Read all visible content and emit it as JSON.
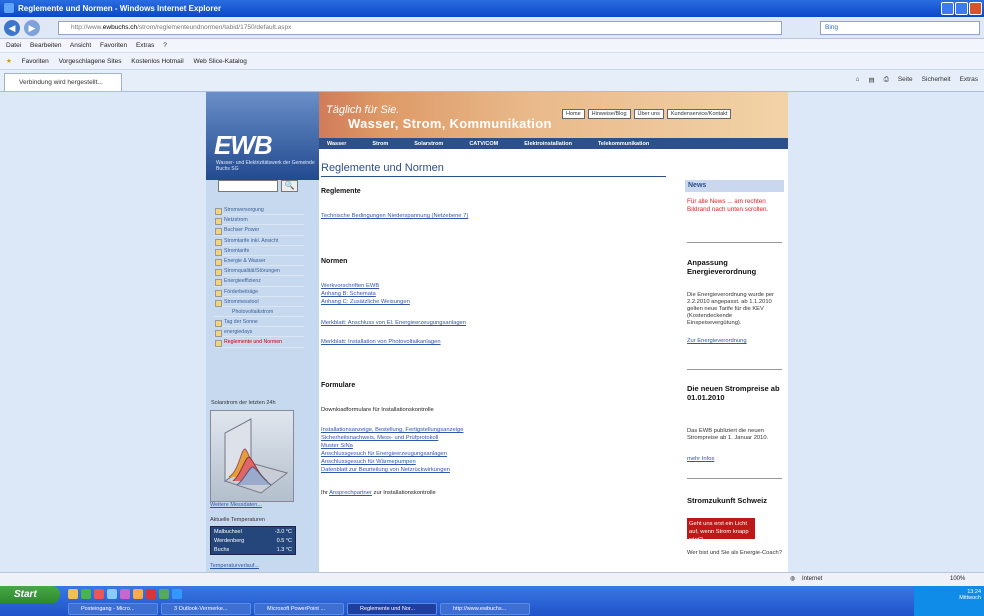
{
  "window": {
    "title": "Reglemente und Normen - Windows Internet Explorer"
  },
  "address": {
    "url_prefix": "http://www.",
    "url_domain": "ewbuchs.ch",
    "url_path": "/strom/reglementeundnormen/tabid/1750/default.aspx",
    "search_placeholder": "Bing"
  },
  "menu": [
    "Datei",
    "Bearbeiten",
    "Ansicht",
    "Favoriten",
    "Extras",
    "?"
  ],
  "favorites": {
    "label": "Favoriten",
    "items": [
      "Vorgeschlagene Sites",
      "Kostenlos Hotmail",
      "Web Slice-Katalog"
    ]
  },
  "tab": {
    "label": "Verbindung wird hergestellt..."
  },
  "commandbar": [
    "Seite",
    "Sicherheit",
    "Extras"
  ],
  "site": {
    "slogan1": "Täglich für Sie.",
    "slogan2": "Wasser, Strom, Kommunikation",
    "logo": "EWB",
    "logo_sub": "Wasser- und Elektrizitätswerk der Gemeinde Buchs SG",
    "toplinks": [
      "Home",
      "Hinweise/Blog",
      "Über uns",
      "Kundenservice/Kontakt"
    ],
    "mainnav": [
      "Wasser",
      "Strom",
      "Solarstrom",
      "CATV/COM",
      "Elektroinstallation",
      "Telekommunikation"
    ],
    "search_btn": "🔍",
    "leftnav": [
      {
        "label": "Stromversorgung",
        "sub": false,
        "active": false
      },
      {
        "label": "Netzstrom",
        "sub": false,
        "active": false
      },
      {
        "label": "Buchser Power",
        "sub": false,
        "active": false
      },
      {
        "label": "Stromtarife inkl. Ansicht",
        "sub": false,
        "active": false
      },
      {
        "label": "Stromtarife",
        "sub": false,
        "active": false
      },
      {
        "label": "Energie & Wasser",
        "sub": false,
        "active": false
      },
      {
        "label": "Stromqualität/Störungen",
        "sub": false,
        "active": false
      },
      {
        "label": "Energieeffizienz",
        "sub": false,
        "active": false
      },
      {
        "label": "Förderbeiträge",
        "sub": false,
        "active": false
      },
      {
        "label": "Strommesstool",
        "sub": false,
        "active": false
      },
      {
        "label": "Photovoltaikstrom",
        "sub": true,
        "active": false
      },
      {
        "label": "Tag der Sonne",
        "sub": false,
        "active": false
      },
      {
        "label": "energiedays",
        "sub": false,
        "active": false
      },
      {
        "label": "Reglemente und Normen",
        "sub": false,
        "active": true
      }
    ],
    "chart_label": "Solarstrom der letzten 24h",
    "chart_more": "Weitere Messdaten...",
    "temp_label": "Aktuelle Temperaturen",
    "temps": [
      {
        "place": "Malbuchsel",
        "value": "-3.0 °C"
      },
      {
        "place": "Werdenberg",
        "value": "0.5 °C"
      },
      {
        "place": "Buchs",
        "value": "1.3 °C"
      }
    ],
    "temp_more": "Temperaturverlauf..."
  },
  "main": {
    "title": "Reglemente und Normen",
    "h_reglemente": "Reglemente",
    "link_tab": "Technische Bedingungen Niederspannung (Netzebene 7)",
    "h_normen": "Normen",
    "normen_links": [
      "Werkvorschriften EWB",
      "Anhang B: Schemata",
      "Anhang C: Zusätzliche Weisungen"
    ],
    "merkblatt1": "Merkblatt: Anschluss von El. Energieerzeugungsanlagen",
    "merkblatt2": "Merkblatt: Installation von Photovoltaikanlagen",
    "h_formulare": "Formulare",
    "downloads_label": "Downloadformulare für Installationskontrolle",
    "form_links": [
      "Installationsanzeige, Bestellung, Fertigstellungsanzeige",
      "Sicherheitsnachweis, Mess- und Prüfprotokoll",
      "Muster SiNa",
      "Anschlussgesuch für Energieerzeugungsanlagen",
      "Anschlussgesuch für Wärmepumpen",
      "Datenblatt zur Beurteilung von Netzrückwirkungen"
    ],
    "footer_pre": "Ihr",
    "footer_link": "Ansprechpartner",
    "footer_post": "zur Installationskontrolle"
  },
  "news": {
    "head": "News",
    "intro": "Für alle News ... am rechten Bildrand nach unten scrollen.",
    "n1_title": "Anpassung Energieverordnung",
    "n1_text": "Die Energieverordnung wurde per 2.2.2010 angepasst. ab 1.1.2010 gelten neue Tarife für die KEV (Kostendeckende Einspeisevergütung).",
    "n1_link": "Zur Energieverordnung",
    "n2_title": "Die neuen Strompreise ab 01.01.2010",
    "n2_text": "Das EWB publiziert die neuen Strompreise ab 1. Januar 2010.",
    "n2_link": "mehr Infos",
    "n3_title": "Stromzukunft Schweiz",
    "n3_box": "Geht uns erst ein Licht auf, wenn Strom knapp wird?",
    "n3_text": "Wer bist und Sie als Energie-Coach?"
  },
  "status": {
    "zone": "Internet",
    "zoom": "100%"
  },
  "taskbar": {
    "start": "Start",
    "tasks": [
      "Posteingang - Micro...",
      "3 Outlook-Vermerke...",
      "Microsoft PowerPoint ...",
      "Reglemente und Nor...",
      "http://www.ewbuchs..."
    ],
    "time": "13:24",
    "day": "Mittwoch"
  },
  "colors": {
    "titlebar": "#0b47c8",
    "nav": "#2d4f8a",
    "accent_red": "#c01818"
  }
}
